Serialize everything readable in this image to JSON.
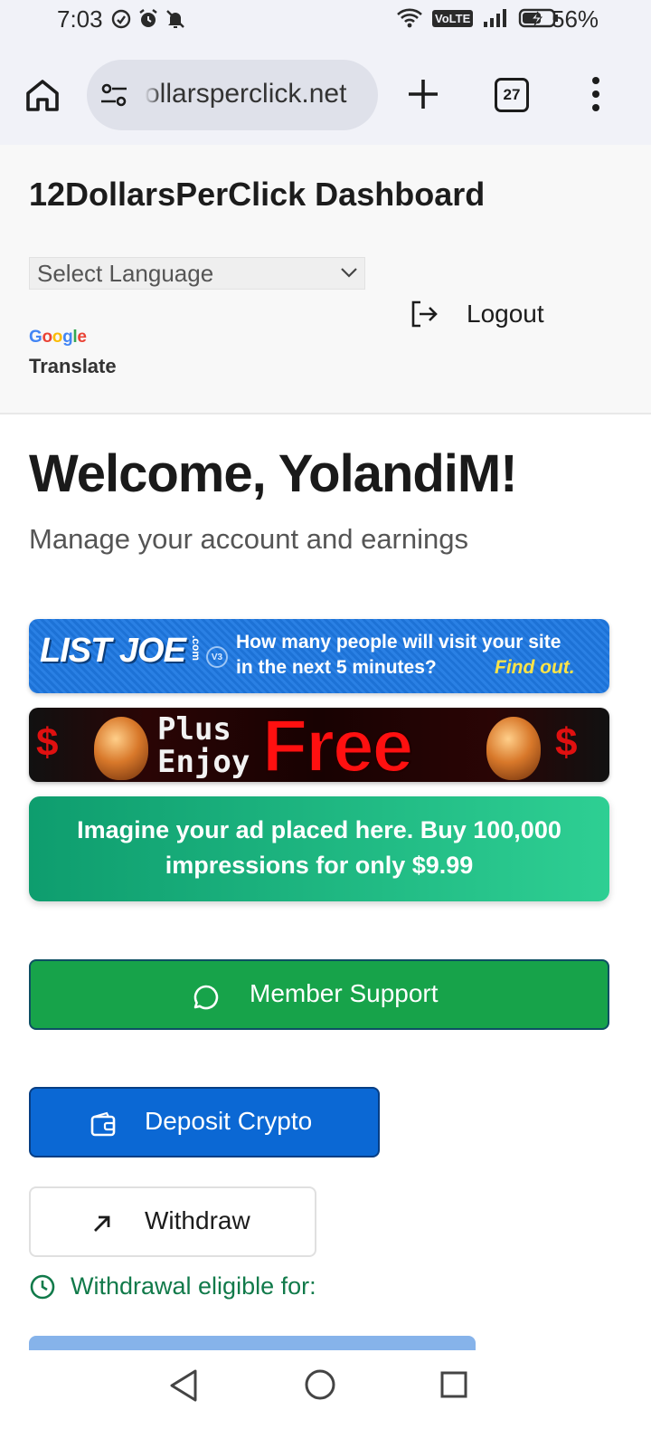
{
  "status_bar": {
    "time": "7:03",
    "battery": "56%",
    "network_badge": "VoLTE",
    "icons": [
      "sync-icon",
      "alarm-icon",
      "bell-off-icon",
      "wifi-icon",
      "signal-icon",
      "battery-charging-icon"
    ]
  },
  "browser": {
    "url": "ollarsperclick.net",
    "tab_count": "27"
  },
  "header": {
    "title": "12DollarsPerClick Dashboard",
    "language_select": "Select Language",
    "google_brand": "Google",
    "translate_label": "Translate",
    "logout_label": "Logout"
  },
  "main": {
    "welcome": "Welcome, YolandiM!",
    "subtitle": "Manage your account and earnings"
  },
  "ads": {
    "listjoe": {
      "brand": "LIST JOE",
      "domain_suffix": ".com",
      "version": "V3",
      "line1": "How many people will visit your site",
      "line2": "in the next 5 minutes?",
      "cta": "Find out."
    },
    "free_banner": {
      "line1": "Plus",
      "line2": "Enjoy",
      "big": "Free",
      "left_symbol": "$",
      "right_symbol": "$"
    },
    "promo": {
      "line1": "Imagine your ad placed here. Buy 100,000",
      "line2": "impressions for only $9.99"
    }
  },
  "actions": {
    "support": "Member Support",
    "deposit": "Deposit Crypto",
    "withdraw": "Withdraw",
    "eligible": "Withdrawal eligible for:"
  },
  "colors": {
    "support_green": "#17a34a",
    "deposit_blue": "#0b68d4",
    "eligible_green": "#117a4a",
    "promo_gradient_start": "#0e9d6e",
    "promo_gradient_end": "#2ecf93"
  }
}
